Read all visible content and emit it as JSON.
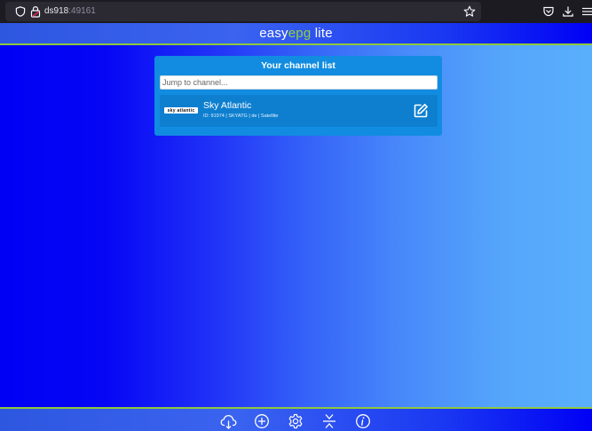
{
  "browser": {
    "url_host": "ds918",
    "url_port": ":49161",
    "icons": [
      "shield-icon",
      "lock-icon",
      "bookmark-star-icon",
      "pocket-icon",
      "download-icon",
      "menu-icon"
    ]
  },
  "header": {
    "brand_prefix": "easy",
    "brand_accent": "epg",
    "brand_suffix": " lite",
    "accent_color": "#8fd33a"
  },
  "channel_list": {
    "title": "Your channel list",
    "search_placeholder": "Jump to channel...",
    "channels": [
      {
        "logo_text": "sky atlantic",
        "name": "Sky Atlantic",
        "meta": "ID: 91974 | SKYATG | de | Satellite"
      }
    ]
  },
  "footer": {
    "tools": [
      "cloud-download-icon",
      "add-icon",
      "settings-icon",
      "collapse-icon",
      "info-icon"
    ]
  }
}
